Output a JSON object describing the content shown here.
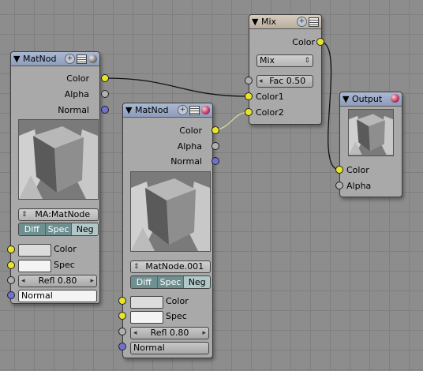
{
  "nodes": {
    "matnode_left": {
      "title": "MatNod",
      "outputs": [
        "Color",
        "Alpha",
        "Normal"
      ],
      "material_name": "MA:MatNode",
      "toggles": [
        "Diff",
        "Spec",
        "Neg"
      ],
      "inputs": {
        "color": "Color",
        "spec": "Spec",
        "refl": "Refl 0.80",
        "normal": "Normal"
      }
    },
    "matnode_mid": {
      "title": "MatNod",
      "outputs": [
        "Color",
        "Alpha",
        "Normal"
      ],
      "material_name": "MatNode.001",
      "toggles": [
        "Diff",
        "Spec",
        "Neg"
      ],
      "inputs": {
        "color": "Color",
        "spec": "Spec",
        "refl": "Refl 0.80",
        "normal": "Normal"
      }
    },
    "mix": {
      "title": "Mix",
      "output": "Color",
      "blend_mode": "Mix",
      "fac": "Fac 0.50",
      "inputs": [
        "Color1",
        "Color2"
      ]
    },
    "output": {
      "title": "Output",
      "inputs": [
        "Color",
        "Alpha"
      ]
    }
  },
  "colors": {
    "socket_color": "#e8e42a",
    "socket_value": "#b0b0b0",
    "socket_vector": "#7070d0",
    "header_material": "#9aa8c4",
    "header_mix": "#c8bfb0",
    "toggle_on": "#6f9090"
  },
  "icons": [
    "collapse-arrow-icon",
    "plus-icon",
    "menu-icon",
    "preview-sphere-icon"
  ]
}
